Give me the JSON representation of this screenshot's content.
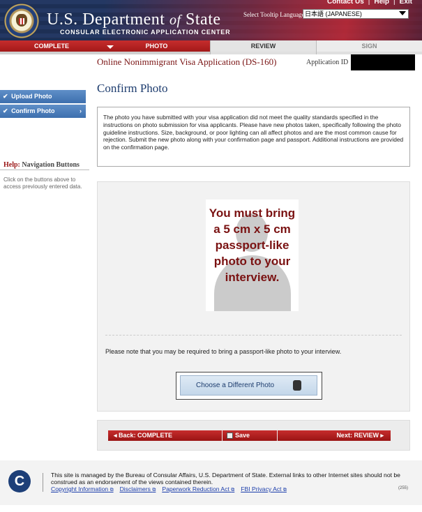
{
  "header": {
    "title_main": "U.S. Department",
    "title_of": "of",
    "title_state": "State",
    "subtitle": "CONSULAR ELECTRONIC APPLICATION CENTER",
    "top_links": [
      "Contact Us",
      "Help",
      "Exit"
    ],
    "tooltip_label": "Select Tooltip Language",
    "language_value": "日本語 (JAPANESE)"
  },
  "tabs": [
    {
      "label": "COMPLETE",
      "state": "done"
    },
    {
      "label": "PHOTO",
      "state": "active"
    },
    {
      "label": "REVIEW",
      "state": "next"
    },
    {
      "label": "SIGN",
      "state": "disabled"
    }
  ],
  "app": {
    "title": "Online Nonimmigrant Visa Application (DS-160)",
    "id_label": "Application ID"
  },
  "sidebar": {
    "items": [
      {
        "label": "Upload Photo",
        "checked": true
      },
      {
        "label": "Confirm Photo",
        "checked": true
      }
    ],
    "help_prefix": "Help:",
    "help_title": "Navigation Buttons",
    "help_text": "Click on the buttons above to access previously entered data."
  },
  "main": {
    "page_title": "Confirm Photo",
    "notice": "The photo you have submitted with your visa application did not meet the quality standards specified in the instructions on photo submission for visa applicants. Please have new photos taken, specifically following the photo guideline instructions. Size, background, or poor lighting can all affect photos and are the most common cause for rejection. Submit the new photo along with your confirmation page and passport. Additional instructions are provided on the confirmation page.",
    "photo_message": "You must bring a 5 cm x 5 cm passport-like photo to your interview.",
    "note": "Please note that you may be required to bring a passport-like photo to your interview.",
    "choose_button": "Choose a Different Photo"
  },
  "bottom_nav": {
    "back": "Back: COMPLETE",
    "save": "Save",
    "next": "Next: REVIEW"
  },
  "footer": {
    "text": "This site is managed by the Bureau of Consular Affairs, U.S. Department of State. External links to other Internet sites should not be construed as an endorsement of the views contained therein.",
    "links": [
      "Copyright Information",
      "Disclaimers",
      "Paperwork Reduction Act",
      "FBI Privacy Act"
    ],
    "code": "(255)"
  }
}
